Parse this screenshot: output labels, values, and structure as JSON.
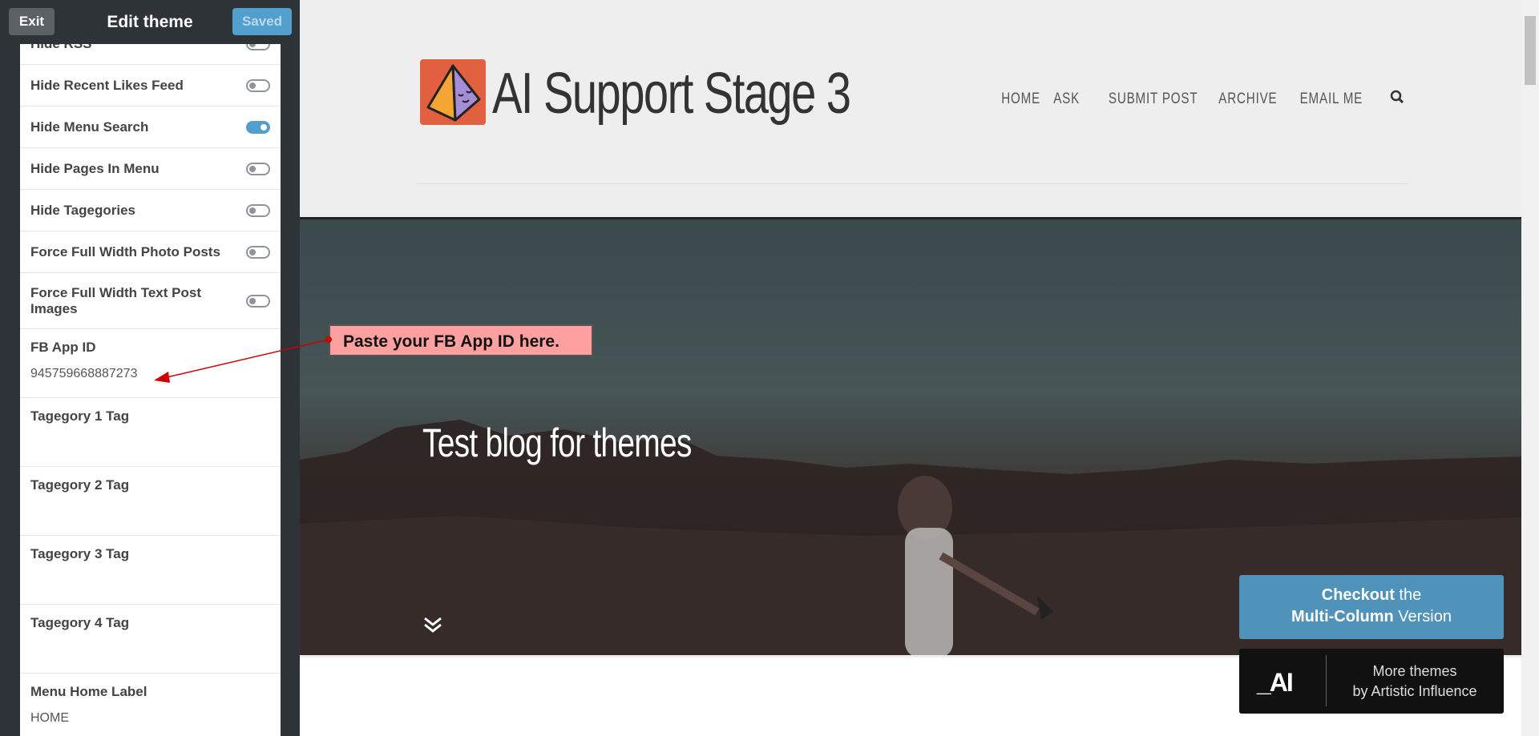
{
  "editor": {
    "exit_label": "Exit",
    "title": "Edit theme",
    "saved_label": "Saved",
    "toggles": [
      {
        "label": "Hide RSS",
        "on": false
      },
      {
        "label": "Hide Recent Likes Feed",
        "on": false
      },
      {
        "label": "Hide Menu Search",
        "on": true
      },
      {
        "label": "Hide Pages In Menu",
        "on": false
      },
      {
        "label": "Hide Tagegories",
        "on": false
      },
      {
        "label": "Force Full Width Photo Posts",
        "on": false
      },
      {
        "label": "Force Full Width Text Post Images",
        "on": false
      }
    ],
    "fields": [
      {
        "label": "FB App ID",
        "value": "945759668887273"
      },
      {
        "label": "Tagegory 1 Tag",
        "value": ""
      },
      {
        "label": "Tagegory 2 Tag",
        "value": ""
      },
      {
        "label": "Tagegory 3 Tag",
        "value": ""
      },
      {
        "label": "Tagegory 4 Tag",
        "value": ""
      },
      {
        "label": "Menu Home Label",
        "value": "HOME"
      }
    ]
  },
  "annotation": {
    "text": "Paste your FB App ID here.",
    "color": "#ffa0a0",
    "arrow_color": "#cc0000"
  },
  "preview": {
    "blog_title": "AI Support Stage 3",
    "nav": [
      "HOME",
      "ASK",
      "SUBMIT POST",
      "ARCHIVE",
      "EMAIL ME"
    ],
    "search_icon": "search-icon",
    "hero_title": "Test blog for themes",
    "scroll_icon": "double-chevron-down-icon",
    "promo_checkout": {
      "bold1": "Checkout",
      "rest1": " the",
      "bold2": "Multi-Column",
      "rest2": " Version"
    },
    "promo_more": {
      "line1": "More themes",
      "line2": "by Artistic Influence",
      "logo_text": "_AI"
    },
    "colors": {
      "logo_bg": "#e0603f",
      "accent": "#529ecc",
      "promo_blue": "#4f93ba"
    }
  }
}
